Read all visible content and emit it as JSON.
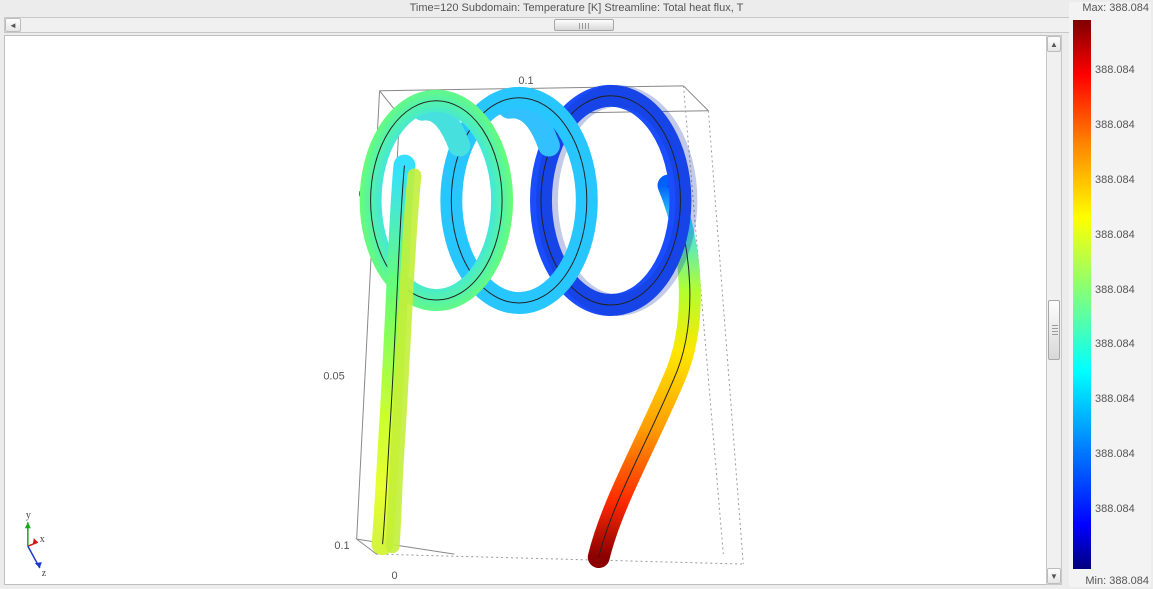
{
  "title": "Time=120   Subdomain: Temperature [K]   Streamline: Total heat flux, T",
  "colorbar": {
    "max_label": "Max: 388.084",
    "min_label": "Min: 388.084",
    "ticks": [
      "388.084",
      "388.084",
      "388.084",
      "388.084",
      "388.084",
      "388.084",
      "388.084",
      "388.084",
      "388.084"
    ]
  },
  "axes": {
    "top_tick": "0.1",
    "left_tick_top": "0",
    "left_tick_mid": "0.05",
    "left_tick_bot": "0.1",
    "bottom_tick": "0"
  },
  "compass": {
    "y": "y",
    "x": "x",
    "z": "z"
  }
}
